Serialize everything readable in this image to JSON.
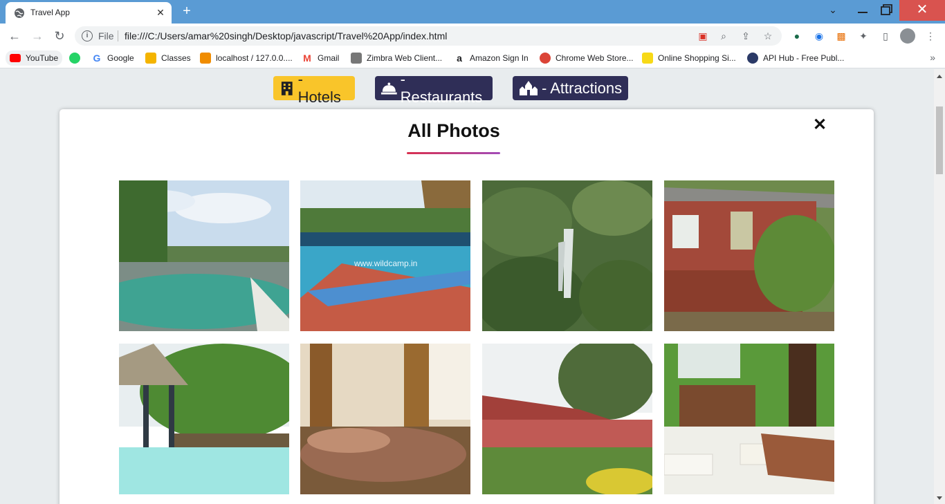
{
  "browser": {
    "tab_title": "Travel App",
    "omnibox_file_label": "File",
    "url": "file:///C:/Users/amar%20singh/Desktop/javascript/Travel%20App/index.html"
  },
  "bookmarks": [
    {
      "label": "YouTube",
      "icon": "youtube-icon",
      "color": "#ff0000"
    },
    {
      "label": "",
      "icon": "whatsapp-icon",
      "color": "#25d366"
    },
    {
      "label": "Google",
      "icon": "google-icon",
      "color": "#4285f4"
    },
    {
      "label": "Classes",
      "icon": "classroom-icon",
      "color": "#f4b400"
    },
    {
      "label": "localhost / 127.0.0....",
      "icon": "phpmyadmin-icon",
      "color": "#f08c00"
    },
    {
      "label": "Gmail",
      "icon": "gmail-icon",
      "color": "#ea4335"
    },
    {
      "label": "Zimbra Web Client...",
      "icon": "zimbra-icon",
      "color": "#555555"
    },
    {
      "label": "Amazon Sign In",
      "icon": "amazon-icon",
      "color": "#ff9900"
    },
    {
      "label": "Chrome Web Store...",
      "icon": "chrome-store-icon",
      "color": "#db4437"
    },
    {
      "label": "Online Shopping Si...",
      "icon": "flipkart-icon",
      "color": "#f7d917"
    },
    {
      "label": "API Hub - Free Publ...",
      "icon": "apihub-icon",
      "color": "#2b3a67"
    }
  ],
  "categories": {
    "hotels": "- Hotels",
    "restaurants": "- Restaurants",
    "attractions": "- Attractions"
  },
  "colors": {
    "hotels_active": "#f9c52a",
    "category_inactive": "#2f2e57",
    "underline_start": "#d9304f",
    "underline_end": "#a24bb8"
  },
  "modal": {
    "title": "All Photos",
    "close": "✕"
  },
  "photos": [
    {
      "name": "photo-round-pool",
      "watermark": ""
    },
    {
      "name": "photo-pool-gazebo",
      "watermark": "www.wildcamp.in"
    },
    {
      "name": "photo-waterfall",
      "watermark": ""
    },
    {
      "name": "photo-red-cottage",
      "watermark": ""
    },
    {
      "name": "photo-pool-hut",
      "watermark": ""
    },
    {
      "name": "photo-bedroom",
      "watermark": ""
    },
    {
      "name": "photo-cottage-row",
      "watermark": ""
    },
    {
      "name": "photo-room-towels",
      "watermark": ""
    }
  ]
}
